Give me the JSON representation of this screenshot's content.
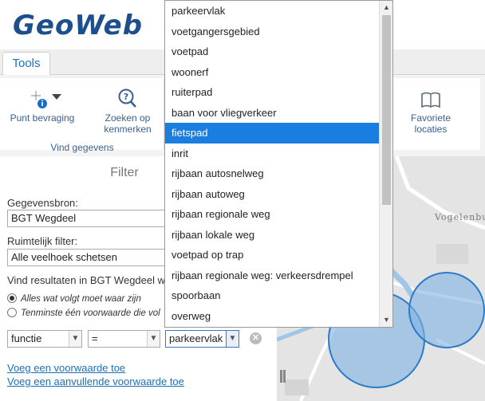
{
  "app": {
    "logo": "GeoWeb"
  },
  "tabs": [
    {
      "label": "Tools"
    }
  ],
  "ribbon": {
    "punt_bevraging": "Punt bevraging",
    "zoeken_line1": "Zoeken op",
    "zoeken_line2": "kenmerken",
    "group_label": "Vind gegevens",
    "favoriete_line1": "Favoriete",
    "favoriete_line2": "locaties"
  },
  "panel": {
    "title": "Filter",
    "gegevensbron_label": "Gegevensbron:",
    "gegevensbron_value": "BGT Wegdeel",
    "ruimtelijk_label": "Ruimtelijk filter:",
    "ruimtelijk_value": "Alle veelhoek schetsen",
    "vind_text": "Vind resultaten in BGT Wegdeel w",
    "radio_all": "Alles wat volgt moet waar zijn",
    "radio_any": "Tenminste één voorwaarde die vol",
    "condition": {
      "field": "functie",
      "operator": "=",
      "value": "parkeervlak"
    },
    "link_add": "Voeg een voorwaarde toe",
    "link_add_extra": "Voeg een aanvullende voorwaarde toe"
  },
  "map": {
    "label": "Vogelenbu"
  },
  "dropdown": {
    "selected": "fietspad",
    "items": [
      "parkeervlak",
      "voetgangersgebied",
      "voetpad",
      "woonerf",
      "ruiterpad",
      "baan voor vliegverkeer",
      "fietspad",
      "inrit",
      "rijbaan autosnelweg",
      "rijbaan autoweg",
      "rijbaan regionale weg",
      "rijbaan lokale weg",
      "voetpad op trap",
      "rijbaan regionale weg: verkeersdrempel",
      "spoorbaan",
      "overweg"
    ]
  },
  "colors": {
    "accent": "#1a7de0",
    "brand": "#1d4f8c",
    "link": "#1d6fb8"
  }
}
